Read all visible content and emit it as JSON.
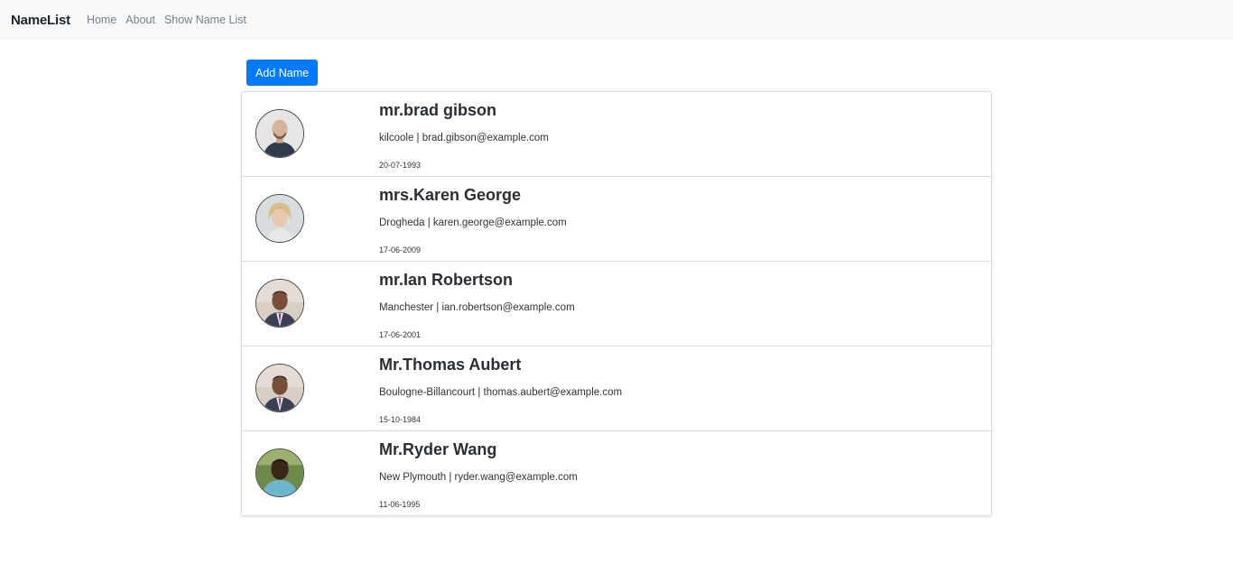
{
  "nav": {
    "brand": "NameList",
    "links": [
      "Home",
      "About",
      "Show Name List"
    ]
  },
  "add_button_label": "Add Name",
  "people": [
    {
      "name": "mr.brad gibson",
      "info": "kilcoole | brad.gibson@example.com",
      "date": "20-07-1993",
      "avatar": "bald-man-avatar"
    },
    {
      "name": "mrs.Karen George",
      "info": "Drogheda | karen.george@example.com",
      "date": "17-06-2009",
      "avatar": "blonde-woman-avatar"
    },
    {
      "name": "mr.Ian Robertson",
      "info": "Manchester | ian.robertson@example.com",
      "date": "17-06-2001",
      "avatar": "man-in-suit-avatar"
    },
    {
      "name": "Mr.Thomas Aubert",
      "info": "Boulogne-Billancourt | thomas.aubert@example.com",
      "date": "15-10-1984",
      "avatar": "man-in-suit-avatar"
    },
    {
      "name": "Mr.Ryder Wang",
      "info": "New Plymouth | ryder.wang@example.com",
      "date": "11-06-1995",
      "avatar": "outdoor-man-avatar"
    }
  ],
  "colors": {
    "primary": "#007bff",
    "navbar_bg": "#f8f9fa"
  }
}
